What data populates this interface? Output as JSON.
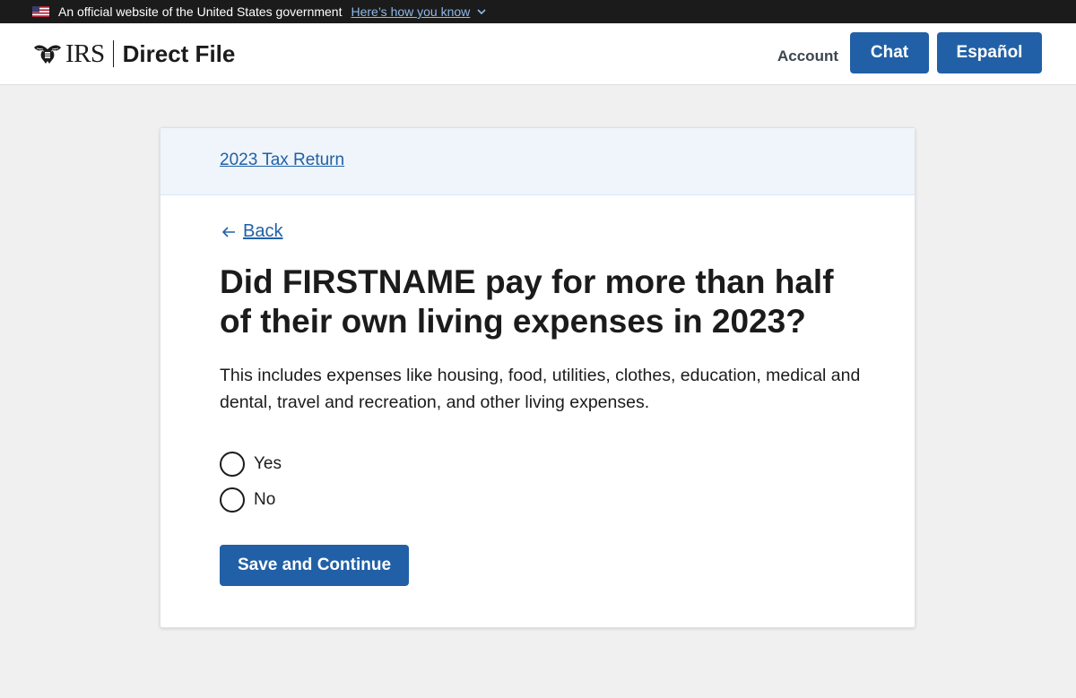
{
  "banner": {
    "text": "An official website of the United States government",
    "link": "Here’s how you know",
    "icons": [
      "us-flag-icon",
      "chevron-down-icon"
    ]
  },
  "header": {
    "logo_irs": "IRS",
    "product": "Direct File",
    "account": "Account",
    "chat": "Chat",
    "espanol": "Español"
  },
  "card": {
    "breadcrumb": "2023 Tax Return",
    "back": "Back",
    "question": "Did FIRSTNAME pay for more than half of their own living expenses in 2023?",
    "hint": "This includes expenses like housing, food, utilities, clothes, education, medical and dental, travel and recreation, and other living expenses.",
    "options": [
      "Yes",
      "No"
    ],
    "submit": "Save and Continue"
  },
  "colors": {
    "primary": "#2160a6",
    "banner_bg": "#1b1b1b",
    "page_bg": "#f0f0f0",
    "card_header_bg": "#eff5fb"
  }
}
